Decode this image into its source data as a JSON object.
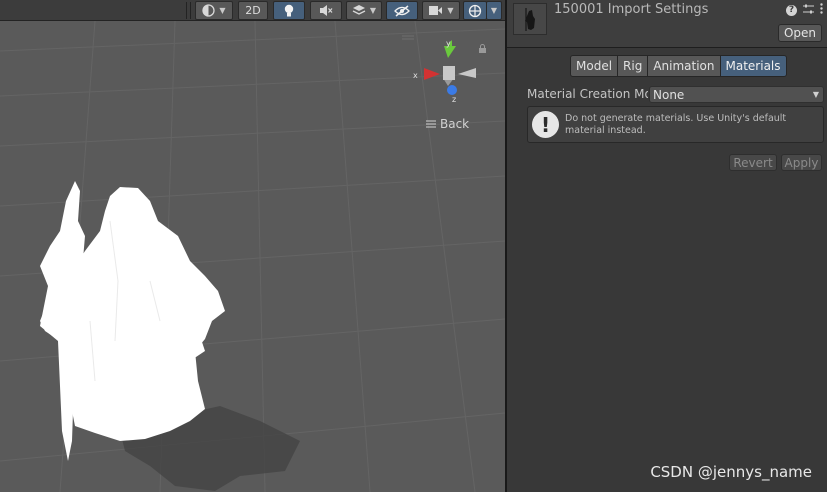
{
  "scene": {
    "toolbar": {
      "mode_2d_label": "2D"
    },
    "gizmo": {
      "x_label": "x",
      "y_label": "y",
      "z_label": "z",
      "back_label": "Back"
    }
  },
  "inspector": {
    "title": "150001 Import Settings",
    "open_label": "Open",
    "tabs": [
      {
        "label": "Model",
        "active": false
      },
      {
        "label": "Rig",
        "active": false
      },
      {
        "label": "Animation",
        "active": false
      },
      {
        "label": "Materials",
        "active": true
      }
    ],
    "material_creation": {
      "label": "Material Creation Mode",
      "value": "None"
    },
    "help_text": "Do not generate materials. Use Unity's default material instead.",
    "revert_label": "Revert",
    "apply_label": "Apply"
  },
  "watermark": "CSDN @jennys_name",
  "colors": {
    "accent": "#46607c",
    "scene_bg": "#5a5a5a",
    "panel_bg": "#383838",
    "x_axis": "#d23232",
    "y_axis": "#6ac93d",
    "z_axis": "#3b7be6"
  },
  "icons": {
    "shading": "sphere-shading-icon",
    "lighting": "light-bulb-icon",
    "audio": "audio-mute-icon",
    "effects": "layers-effects-icon",
    "visibility": "eye-hidden-icon",
    "camera": "camera-icon",
    "gizmos": "gizmo-globe-icon",
    "help": "help-icon",
    "presets": "sliders-icon",
    "menu": "more-icon",
    "warning": "exclamation-icon"
  }
}
